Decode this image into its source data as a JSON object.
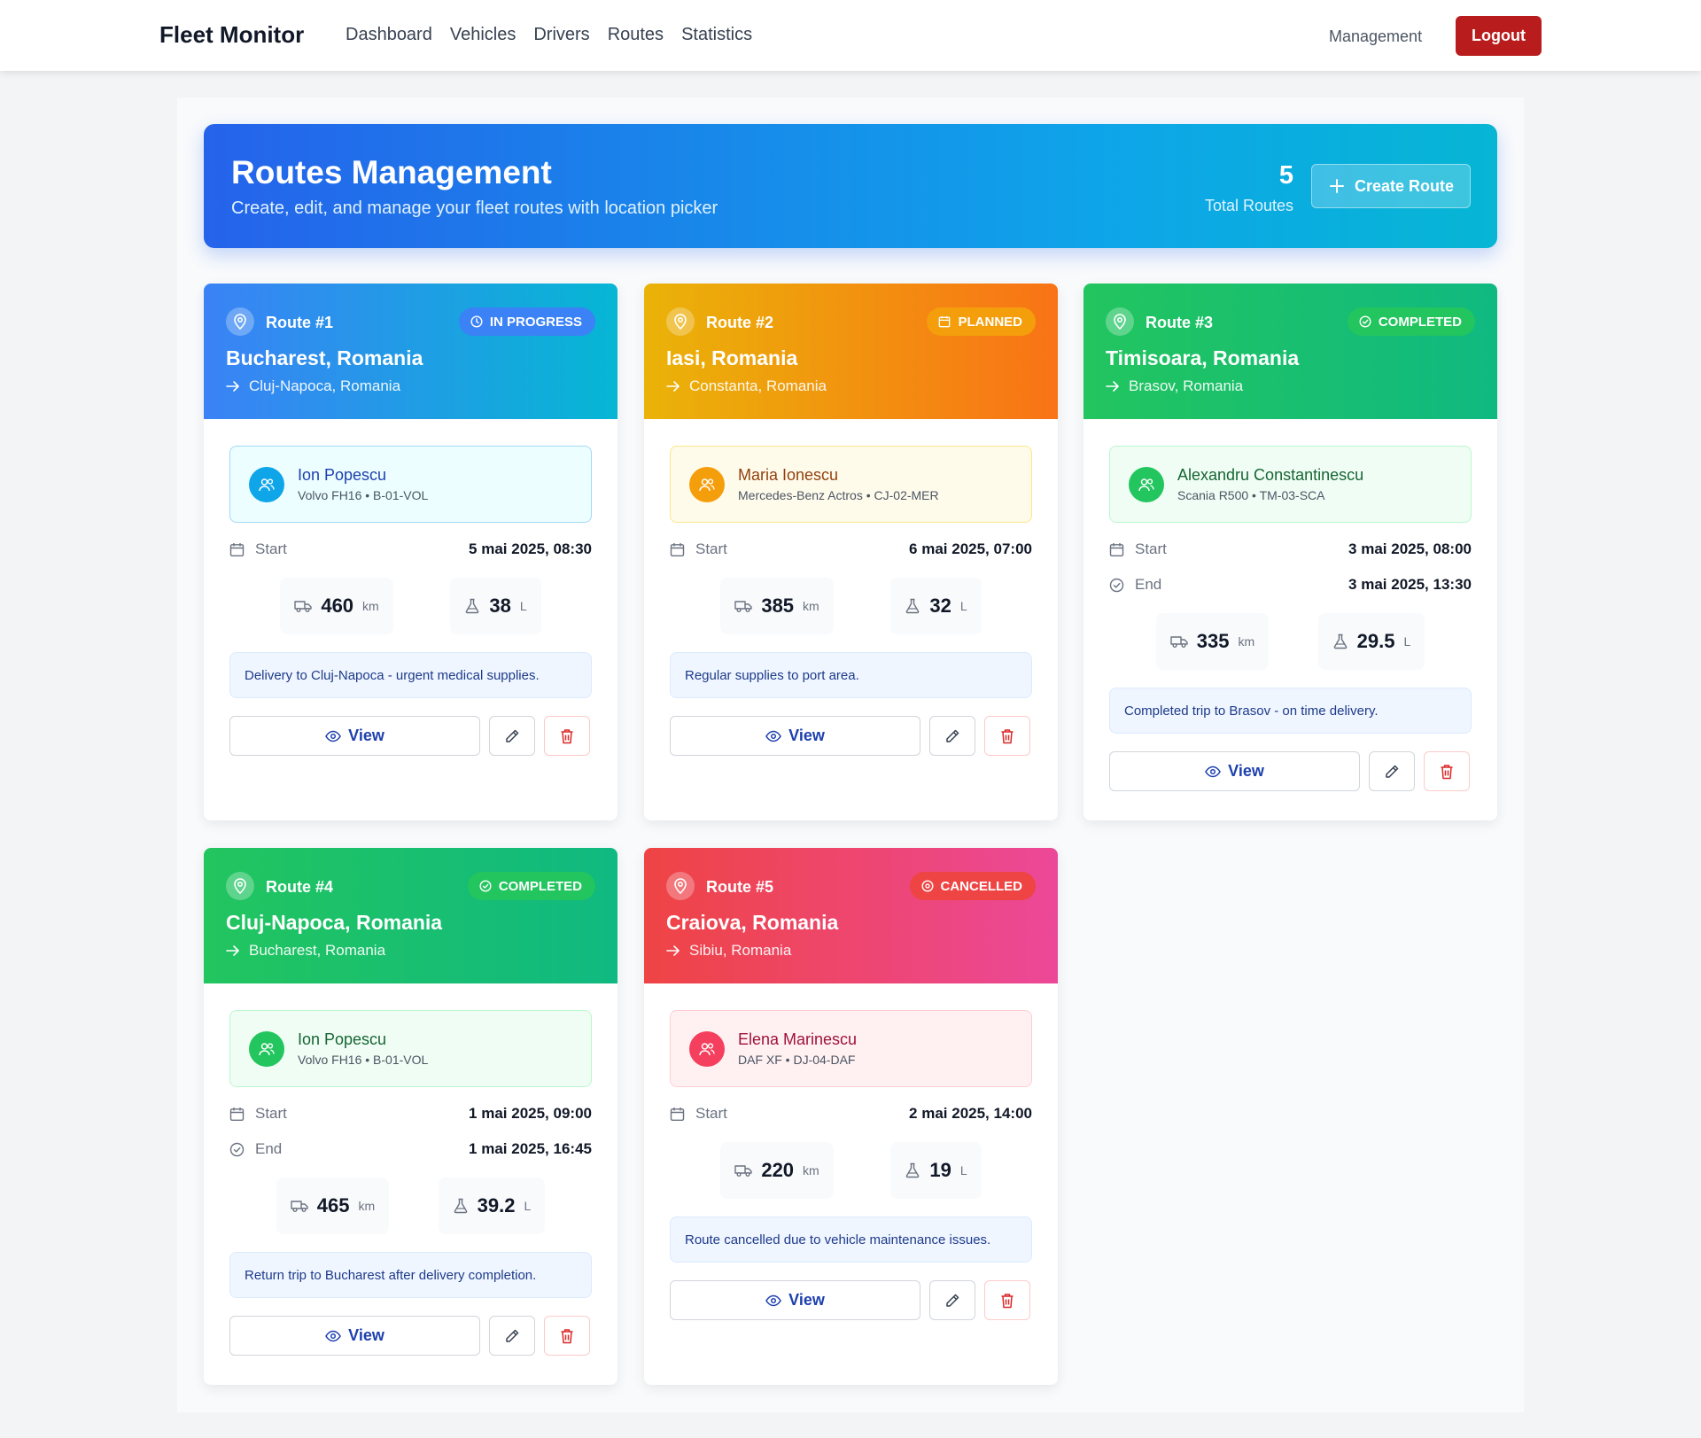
{
  "nav": {
    "brand": "Fleet Monitor",
    "links": [
      "Dashboard",
      "Vehicles",
      "Drivers",
      "Routes",
      "Statistics"
    ],
    "right_link": "Management",
    "logout": "Logout"
  },
  "hero": {
    "title": "Routes Management",
    "subtitle": "Create, edit, and manage your fleet routes with location picker",
    "total_count": "5",
    "total_label": "Total Routes",
    "create_label": "Create Route"
  },
  "labels": {
    "start": "Start",
    "end": "End",
    "km": "km",
    "liters": "L",
    "view": "View"
  },
  "colors": {
    "brand_blue": "#2563eb",
    "logout_red": "#b91c1c",
    "in_progress": "#3b82f6",
    "planned": "#f59e0b",
    "completed": "#22c55e",
    "cancelled": "#ef4444"
  },
  "routes": [
    {
      "title": "Route #1",
      "status": "IN PROGRESS",
      "status_icon": "clock-icon",
      "from": "Bucharest, Romania",
      "to": "Cluj-Napoca, Romania",
      "driver": "Ion Popescu",
      "vehicle": "Volvo FH16 • B-01-VOL",
      "start": "5 mai 2025, 08:30",
      "end": "",
      "distance": "460",
      "fuel": "38",
      "note": "Delivery to Cluj-Napoca - urgent medical supplies."
    },
    {
      "title": "Route #2",
      "status": "PLANNED",
      "status_icon": "calendar-icon",
      "from": "Iasi, Romania",
      "to": "Constanta, Romania",
      "driver": "Maria Ionescu",
      "vehicle": "Mercedes-Benz Actros • CJ-02-MER",
      "start": "6 mai 2025, 07:00",
      "end": "",
      "distance": "385",
      "fuel": "32",
      "note": "Regular supplies to port area."
    },
    {
      "title": "Route #3",
      "status": "COMPLETED",
      "status_icon": "check-circle-icon",
      "from": "Timisoara, Romania",
      "to": "Brasov, Romania",
      "driver": "Alexandru Constantinescu",
      "vehicle": "Scania R500 • TM-03-SCA",
      "start": "3 mai 2025, 08:00",
      "end": "3 mai 2025, 13:30",
      "distance": "335",
      "fuel": "29.5",
      "note": "Completed trip to Brasov - on time delivery."
    },
    {
      "title": "Route #4",
      "status": "COMPLETED",
      "status_icon": "check-circle-icon",
      "from": "Cluj-Napoca, Romania",
      "to": "Bucharest, Romania",
      "driver": "Ion Popescu",
      "vehicle": "Volvo FH16 • B-01-VOL",
      "start": "1 mai 2025, 09:00",
      "end": "1 mai 2025, 16:45",
      "distance": "465",
      "fuel": "39.2",
      "note": "Return trip to Bucharest after delivery completion."
    },
    {
      "title": "Route #5",
      "status": "CANCELLED",
      "status_icon": "x-circle-icon",
      "from": "Craiova, Romania",
      "to": "Sibiu, Romania",
      "driver": "Elena Marinescu",
      "vehicle": "DAF XF • DJ-04-DAF",
      "start": "2 mai 2025, 14:00",
      "end": "",
      "distance": "220",
      "fuel": "19",
      "note": "Route cancelled due to vehicle maintenance issues."
    }
  ]
}
